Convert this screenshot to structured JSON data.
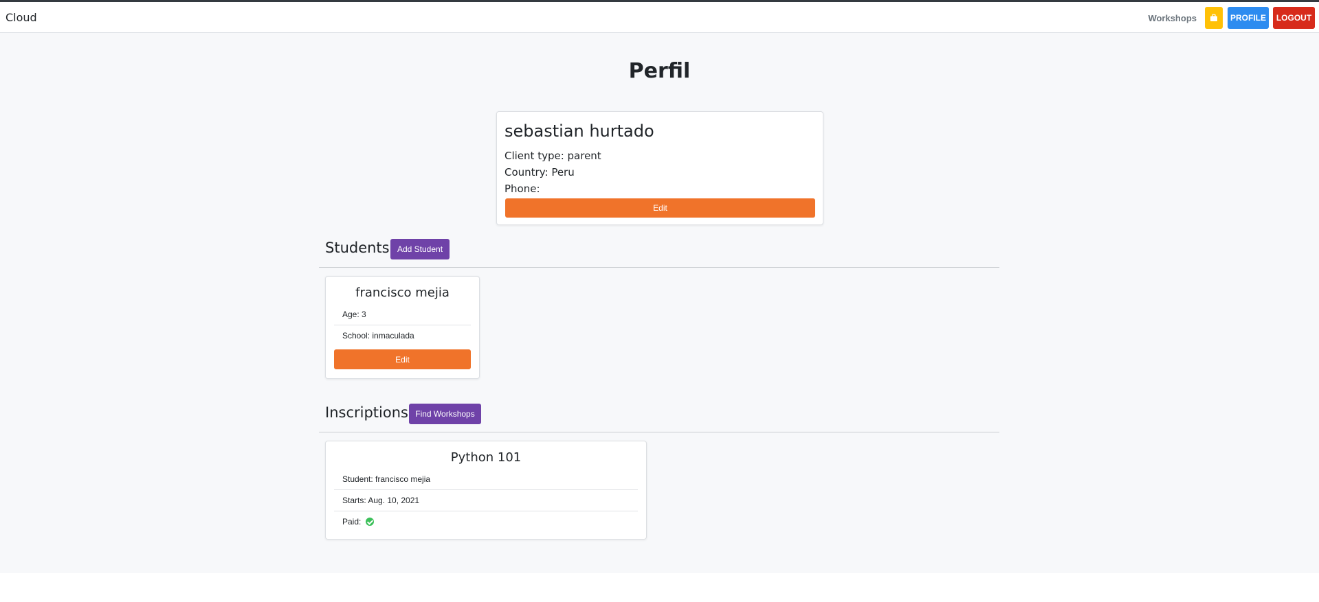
{
  "navbar": {
    "brand": "Cloud",
    "workshops_link": "Workshops",
    "profile_button": "PROFILE",
    "logout_button": "LOGOUT",
    "cart_icon": "briefcase-icon",
    "colors": {
      "cart": "#ffc107",
      "profile": "#2d8cf0",
      "logout": "#d72b1b"
    }
  },
  "page": {
    "title": "Perfil"
  },
  "profile": {
    "name": "sebastian hurtado",
    "client_type": "Client type: parent",
    "country": "Country: Peru",
    "phone": "Phone:",
    "edit_label": "Edit"
  },
  "students": {
    "heading": "Students",
    "add_button": "Add Student",
    "items": [
      {
        "name": "francisco mejia",
        "age": "Age: 3",
        "school": "School: inmaculada",
        "edit_label": "Edit"
      }
    ]
  },
  "inscriptions": {
    "heading": "Inscriptions",
    "find_button": "Find Workshops",
    "items": [
      {
        "workshop": "Python 101",
        "student": "Student: francisco mejia",
        "starts": "Starts: Aug. 10, 2021",
        "paid_label": "Paid:",
        "paid_icon": "check-circle-icon"
      }
    ]
  },
  "colors": {
    "edit": "#f0732a",
    "purple": "#6f42a8",
    "paid": "#3cc05a"
  }
}
